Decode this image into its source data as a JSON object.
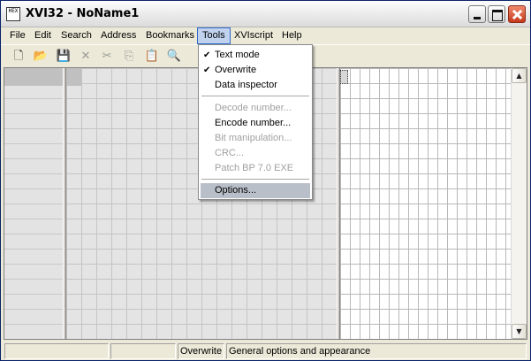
{
  "window": {
    "icon_text": "HEX",
    "title": "XVI32 - NoName1"
  },
  "menubar": {
    "items": [
      {
        "label": "File"
      },
      {
        "label": "Edit"
      },
      {
        "label": "Search"
      },
      {
        "label": "Address"
      },
      {
        "label": "Bookmarks"
      },
      {
        "label": "Tools",
        "open": true
      },
      {
        "label": "XVIscript"
      },
      {
        "label": "Help"
      }
    ]
  },
  "toolbar": {
    "tools": [
      {
        "name": "new-file-icon",
        "glyph": "🗋"
      },
      {
        "name": "open-folder-icon",
        "glyph": "📂"
      },
      {
        "name": "save-icon",
        "glyph": "💾"
      },
      {
        "name": "delete-icon",
        "glyph": "✕",
        "disabled": true
      },
      {
        "name": "cut-icon",
        "glyph": "✂",
        "disabled": true
      },
      {
        "name": "copy-icon",
        "glyph": "⎘",
        "disabled": true
      },
      {
        "name": "paste-icon",
        "glyph": "📋",
        "disabled": true
      },
      {
        "name": "find-icon",
        "glyph": "🔍"
      }
    ]
  },
  "tools_menu": {
    "items": [
      {
        "label": "Text mode",
        "checked": true,
        "enabled": true
      },
      {
        "label": "Overwrite",
        "checked": true,
        "enabled": true
      },
      {
        "label": "Data inspector",
        "checked": false,
        "enabled": true
      },
      {
        "label": "Decode number...",
        "enabled": false
      },
      {
        "label": "Encode number...",
        "enabled": true
      },
      {
        "label": "Bit manipulation...",
        "enabled": false
      },
      {
        "label": "CRC...",
        "enabled": false
      },
      {
        "label": "Patch BP 7.0 EXE",
        "enabled": false
      },
      {
        "label": "Options...",
        "enabled": true,
        "highlighted": true
      }
    ],
    "check_glyph": "✔"
  },
  "statusbar": {
    "cells": [
      "",
      "",
      "Overwrite",
      "General options and appearance"
    ]
  },
  "scrollbar": {
    "up_glyph": "▲",
    "down_glyph": "▼"
  }
}
